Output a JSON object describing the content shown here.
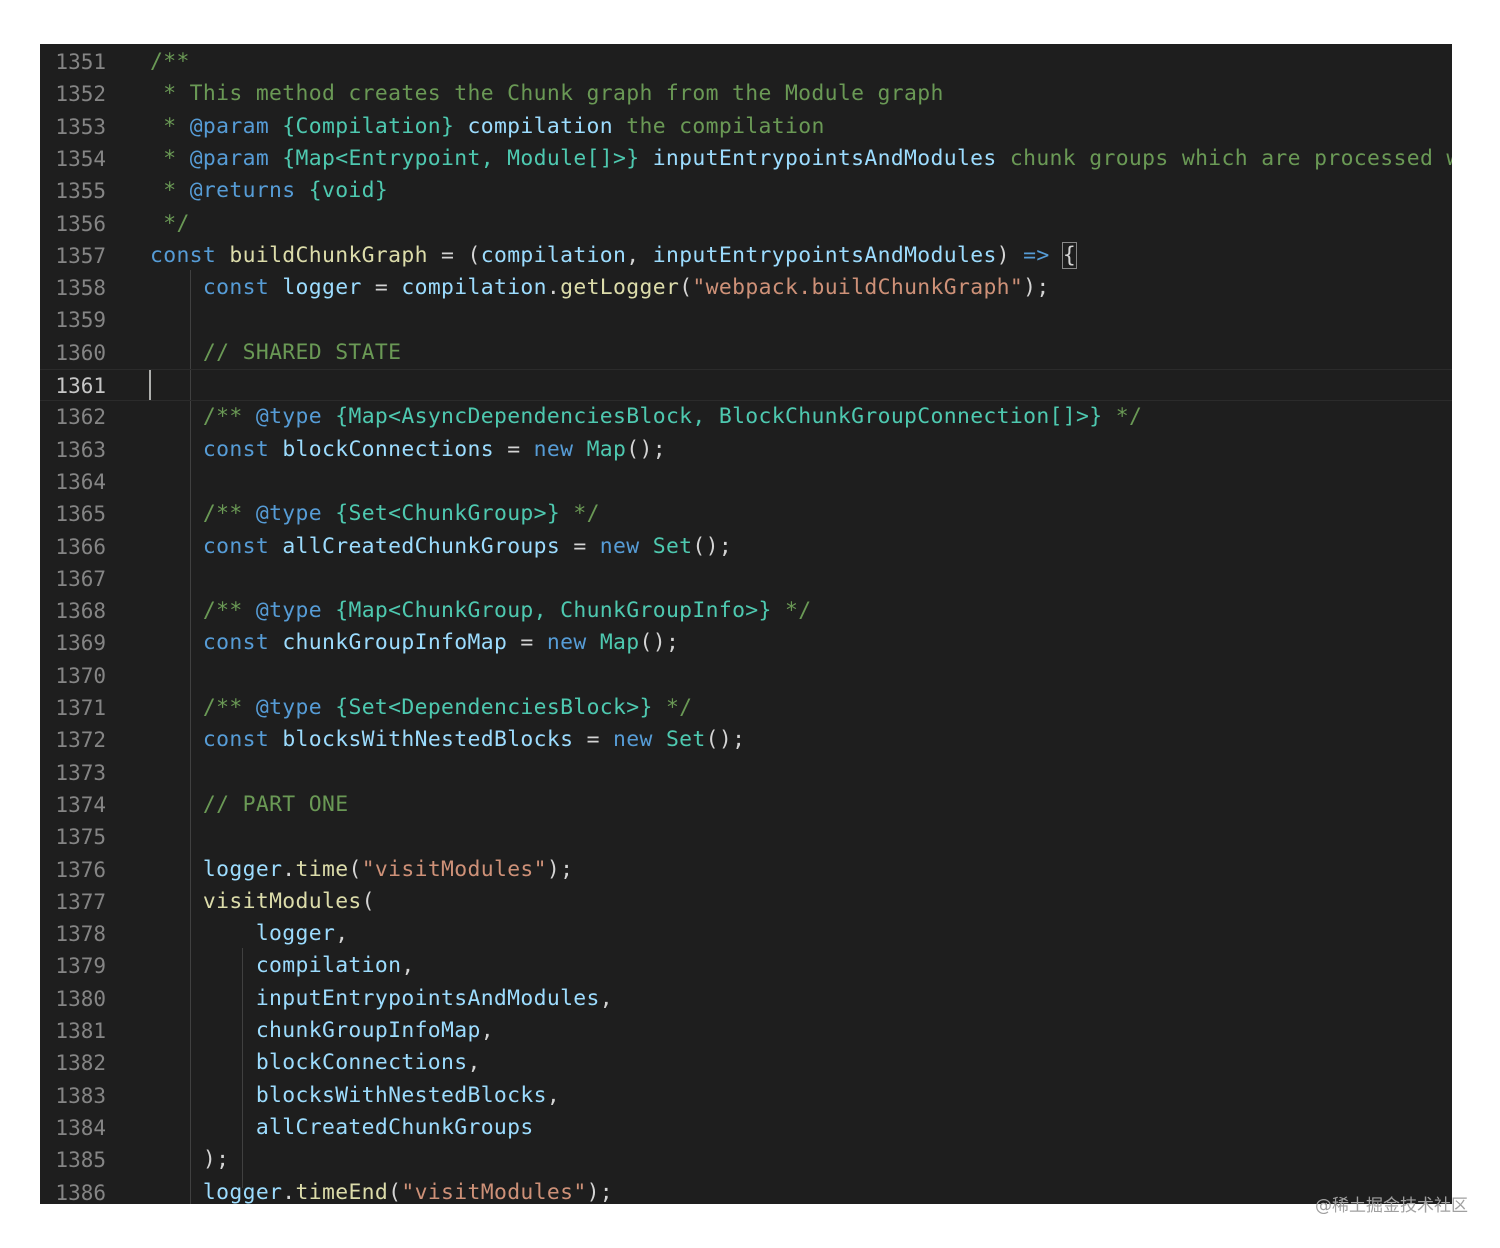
{
  "editor": {
    "colors": {
      "background": "#1e1e1e",
      "comment": "#6a9955",
      "keyword": "#569cd6",
      "variable": "#9cdcfe",
      "function": "#dcdcaa",
      "type": "#4ec9b0",
      "string": "#ce9178",
      "plain": "#d4d4d4",
      "line_number": "#858585"
    },
    "active_line": 1361,
    "lines": [
      {
        "n": "1351",
        "tokens": [
          [
            "c",
            "/**"
          ]
        ]
      },
      {
        "n": "1352",
        "tokens": [
          [
            "c",
            " * This method creates the Chunk graph from the Module graph"
          ]
        ]
      },
      {
        "n": "1353",
        "tokens": [
          [
            "c",
            " * "
          ],
          [
            "k",
            "@param"
          ],
          [
            "c",
            " "
          ],
          [
            "t",
            "{Compilation}"
          ],
          [
            "c",
            " "
          ],
          [
            "v",
            "compilation"
          ],
          [
            "c",
            " the compilation"
          ]
        ]
      },
      {
        "n": "1354",
        "tokens": [
          [
            "c",
            " * "
          ],
          [
            "k",
            "@param"
          ],
          [
            "c",
            " "
          ],
          [
            "t",
            "{Map<Entrypoint, Module[]>}"
          ],
          [
            "c",
            " "
          ],
          [
            "v",
            "inputEntrypointsAndModules"
          ],
          [
            "c",
            " chunk groups which are processed wi"
          ]
        ]
      },
      {
        "n": "1355",
        "tokens": [
          [
            "c",
            " * "
          ],
          [
            "k",
            "@returns"
          ],
          [
            "c",
            " "
          ],
          [
            "t",
            "{void}"
          ]
        ]
      },
      {
        "n": "1356",
        "tokens": [
          [
            "c",
            " */"
          ]
        ]
      },
      {
        "n": "1357",
        "tokens": [
          [
            "k",
            "const"
          ],
          [
            "p",
            " "
          ],
          [
            "f",
            "buildChunkGraph"
          ],
          [
            "p",
            " = ("
          ],
          [
            "v",
            "compilation"
          ],
          [
            "p",
            ", "
          ],
          [
            "v",
            "inputEntrypointsAndModules"
          ],
          [
            "p",
            ") "
          ],
          [
            "k",
            "=>"
          ],
          [
            "p",
            " "
          ],
          [
            "b",
            "{"
          ]
        ]
      },
      {
        "n": "1358",
        "tokens": [
          [
            "p",
            "    "
          ],
          [
            "k",
            "const"
          ],
          [
            "p",
            " "
          ],
          [
            "v",
            "logger"
          ],
          [
            "p",
            " = "
          ],
          [
            "v",
            "compilation"
          ],
          [
            "p",
            "."
          ],
          [
            "f",
            "getLogger"
          ],
          [
            "p",
            "("
          ],
          [
            "s",
            "\"webpack.buildChunkGraph\""
          ],
          [
            "p",
            ");"
          ]
        ]
      },
      {
        "n": "1359",
        "tokens": []
      },
      {
        "n": "1360",
        "tokens": [
          [
            "p",
            "    "
          ],
          [
            "c",
            "// SHARED STATE"
          ]
        ]
      },
      {
        "n": "1361",
        "tokens": []
      },
      {
        "n": "1362",
        "tokens": [
          [
            "p",
            "    "
          ],
          [
            "c",
            "/** "
          ],
          [
            "k",
            "@type"
          ],
          [
            "c",
            " "
          ],
          [
            "t",
            "{Map<AsyncDependenciesBlock, BlockChunkGroupConnection[]>}"
          ],
          [
            "c",
            " */"
          ]
        ]
      },
      {
        "n": "1363",
        "tokens": [
          [
            "p",
            "    "
          ],
          [
            "k",
            "const"
          ],
          [
            "p",
            " "
          ],
          [
            "v",
            "blockConnections"
          ],
          [
            "p",
            " = "
          ],
          [
            "k",
            "new"
          ],
          [
            "p",
            " "
          ],
          [
            "t",
            "Map"
          ],
          [
            "p",
            "();"
          ]
        ]
      },
      {
        "n": "1364",
        "tokens": []
      },
      {
        "n": "1365",
        "tokens": [
          [
            "p",
            "    "
          ],
          [
            "c",
            "/** "
          ],
          [
            "k",
            "@type"
          ],
          [
            "c",
            " "
          ],
          [
            "t",
            "{Set<ChunkGroup>}"
          ],
          [
            "c",
            " */"
          ]
        ]
      },
      {
        "n": "1366",
        "tokens": [
          [
            "p",
            "    "
          ],
          [
            "k",
            "const"
          ],
          [
            "p",
            " "
          ],
          [
            "v",
            "allCreatedChunkGroups"
          ],
          [
            "p",
            " = "
          ],
          [
            "k",
            "new"
          ],
          [
            "p",
            " "
          ],
          [
            "t",
            "Set"
          ],
          [
            "p",
            "();"
          ]
        ]
      },
      {
        "n": "1367",
        "tokens": []
      },
      {
        "n": "1368",
        "tokens": [
          [
            "p",
            "    "
          ],
          [
            "c",
            "/** "
          ],
          [
            "k",
            "@type"
          ],
          [
            "c",
            " "
          ],
          [
            "t",
            "{Map<ChunkGroup, ChunkGroupInfo>}"
          ],
          [
            "c",
            " */"
          ]
        ]
      },
      {
        "n": "1369",
        "tokens": [
          [
            "p",
            "    "
          ],
          [
            "k",
            "const"
          ],
          [
            "p",
            " "
          ],
          [
            "v",
            "chunkGroupInfoMap"
          ],
          [
            "p",
            " = "
          ],
          [
            "k",
            "new"
          ],
          [
            "p",
            " "
          ],
          [
            "t",
            "Map"
          ],
          [
            "p",
            "();"
          ]
        ]
      },
      {
        "n": "1370",
        "tokens": []
      },
      {
        "n": "1371",
        "tokens": [
          [
            "p",
            "    "
          ],
          [
            "c",
            "/** "
          ],
          [
            "k",
            "@type"
          ],
          [
            "c",
            " "
          ],
          [
            "t",
            "{Set<DependenciesBlock>}"
          ],
          [
            "c",
            " */"
          ]
        ]
      },
      {
        "n": "1372",
        "tokens": [
          [
            "p",
            "    "
          ],
          [
            "k",
            "const"
          ],
          [
            "p",
            " "
          ],
          [
            "v",
            "blocksWithNestedBlocks"
          ],
          [
            "p",
            " = "
          ],
          [
            "k",
            "new"
          ],
          [
            "p",
            " "
          ],
          [
            "t",
            "Set"
          ],
          [
            "p",
            "();"
          ]
        ]
      },
      {
        "n": "1373",
        "tokens": []
      },
      {
        "n": "1374",
        "tokens": [
          [
            "p",
            "    "
          ],
          [
            "c",
            "// PART ONE"
          ]
        ]
      },
      {
        "n": "1375",
        "tokens": []
      },
      {
        "n": "1376",
        "tokens": [
          [
            "p",
            "    "
          ],
          [
            "v",
            "logger"
          ],
          [
            "p",
            "."
          ],
          [
            "f",
            "time"
          ],
          [
            "p",
            "("
          ],
          [
            "s",
            "\"visitModules\""
          ],
          [
            "p",
            ");"
          ]
        ]
      },
      {
        "n": "1377",
        "tokens": [
          [
            "p",
            "    "
          ],
          [
            "f",
            "visitModules"
          ],
          [
            "p",
            "("
          ]
        ]
      },
      {
        "n": "1378",
        "tokens": [
          [
            "p",
            "        "
          ],
          [
            "v",
            "logger"
          ],
          [
            "p",
            ","
          ]
        ]
      },
      {
        "n": "1379",
        "tokens": [
          [
            "p",
            "        "
          ],
          [
            "v",
            "compilation"
          ],
          [
            "p",
            ","
          ]
        ]
      },
      {
        "n": "1380",
        "tokens": [
          [
            "p",
            "        "
          ],
          [
            "v",
            "inputEntrypointsAndModules"
          ],
          [
            "p",
            ","
          ]
        ]
      },
      {
        "n": "1381",
        "tokens": [
          [
            "p",
            "        "
          ],
          [
            "v",
            "chunkGroupInfoMap"
          ],
          [
            "p",
            ","
          ]
        ]
      },
      {
        "n": "1382",
        "tokens": [
          [
            "p",
            "        "
          ],
          [
            "v",
            "blockConnections"
          ],
          [
            "p",
            ","
          ]
        ]
      },
      {
        "n": "1383",
        "tokens": [
          [
            "p",
            "        "
          ],
          [
            "v",
            "blocksWithNestedBlocks"
          ],
          [
            "p",
            ","
          ]
        ]
      },
      {
        "n": "1384",
        "tokens": [
          [
            "p",
            "        "
          ],
          [
            "v",
            "allCreatedChunkGroups"
          ]
        ]
      },
      {
        "n": "1385",
        "tokens": [
          [
            "p",
            "    );"
          ]
        ]
      },
      {
        "n": "1386",
        "tokens": [
          [
            "p",
            "    "
          ],
          [
            "v",
            "logger"
          ],
          [
            "p",
            "."
          ],
          [
            "f",
            "timeEnd"
          ],
          [
            "p",
            "("
          ],
          [
            "s",
            "\"visitModules\""
          ],
          [
            "p",
            ");"
          ]
        ]
      }
    ]
  },
  "watermark": "@稀土掘金技术社区"
}
